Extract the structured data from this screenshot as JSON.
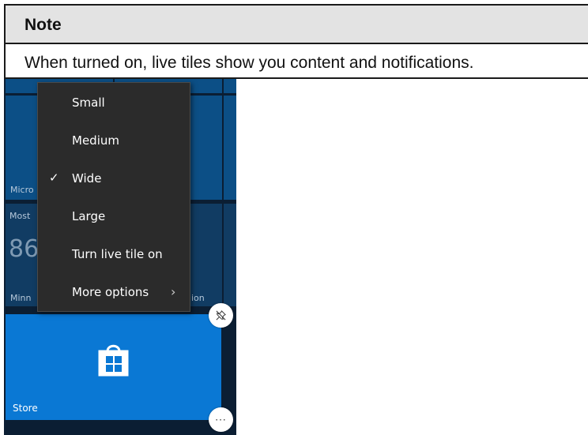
{
  "note": {
    "title": "Note",
    "text": "When turned on, live tiles show you content and notifications."
  },
  "tiles": {
    "label_micro": "Micro",
    "label_most": "Most",
    "label_big_number": "86",
    "label_minn": "Minn",
    "label_ion": "ion",
    "store_label": "Store"
  },
  "context_menu": {
    "items": [
      {
        "label": "Small",
        "checked": false
      },
      {
        "label": "Medium",
        "checked": false
      },
      {
        "label": "Wide",
        "checked": true
      },
      {
        "label": "Large",
        "checked": false
      },
      {
        "label": "Turn live tile on",
        "checked": false
      },
      {
        "label": "More options",
        "checked": false,
        "has_submenu": true
      }
    ],
    "check_glyph": "✓",
    "submenu_glyph": "›"
  },
  "buttons": {
    "unpin_icon": "unpin-icon",
    "more_label": "···"
  },
  "colors": {
    "store_tile": "#0a78d4",
    "dark_tile": "#0c4f86",
    "background": "#0b1e33",
    "menu_bg": "#2b2b2b",
    "note_header": "#e3e3e3"
  }
}
